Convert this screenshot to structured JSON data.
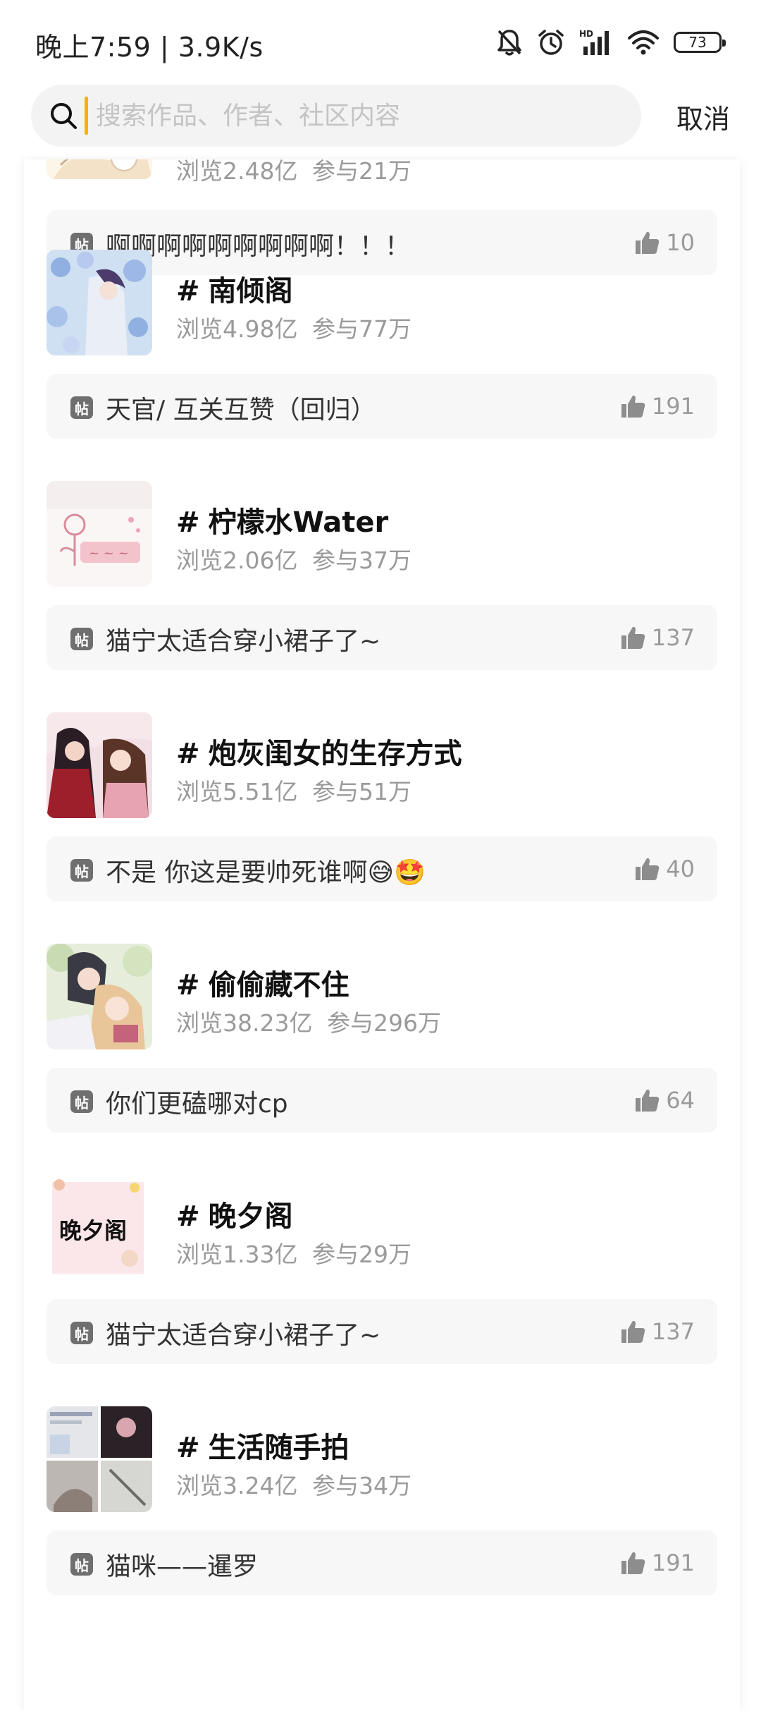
{
  "status_bar": {
    "time": "晚上7:59 | 3.9K/s",
    "battery": "73",
    "icons": [
      "bell-muted-icon",
      "alarm-icon",
      "signal-icon",
      "wifi-icon",
      "battery-icon"
    ]
  },
  "search": {
    "placeholder": "搜索作品、作者、社区内容",
    "cancel_label": "取消",
    "caret_color": "#f5b400"
  },
  "tag_icon_label": "帖",
  "topics": [
    {
      "title": "",
      "views": "浏览2.48亿",
      "participants": "参与21万",
      "post": "啊啊啊啊啊啊啊啊啊！！！",
      "likes": "10"
    },
    {
      "title": "南倾阁",
      "views": "浏览4.98亿",
      "participants": "参与77万",
      "post": "天官/ 互关互赞（回归）",
      "likes": "191"
    },
    {
      "title": "柠檬水Water",
      "views": "浏览2.06亿",
      "participants": "参与37万",
      "post": "猫宁太适合穿小裙子了~",
      "likes": "137"
    },
    {
      "title": "炮灰闺女的生存方式",
      "views": "浏览5.51亿",
      "participants": "参与51万",
      "post": "不是 你这是要帅死谁啊😅🤩",
      "likes": "40"
    },
    {
      "title": "偷偷藏不住",
      "views": "浏览38.23亿",
      "participants": "参与296万",
      "post": "你们更磕哪对cp",
      "likes": "64"
    },
    {
      "title": "晚夕阁",
      "views": "浏览1.33亿",
      "participants": "参与29万",
      "post": "猫宁太适合穿小裙子了~",
      "likes": "137",
      "thumb_text": "晚夕阁"
    },
    {
      "title": "生活随手拍",
      "views": "浏览3.24亿",
      "participants": "参与34万",
      "post": "猫咪——暹罗",
      "likes": "191"
    }
  ]
}
